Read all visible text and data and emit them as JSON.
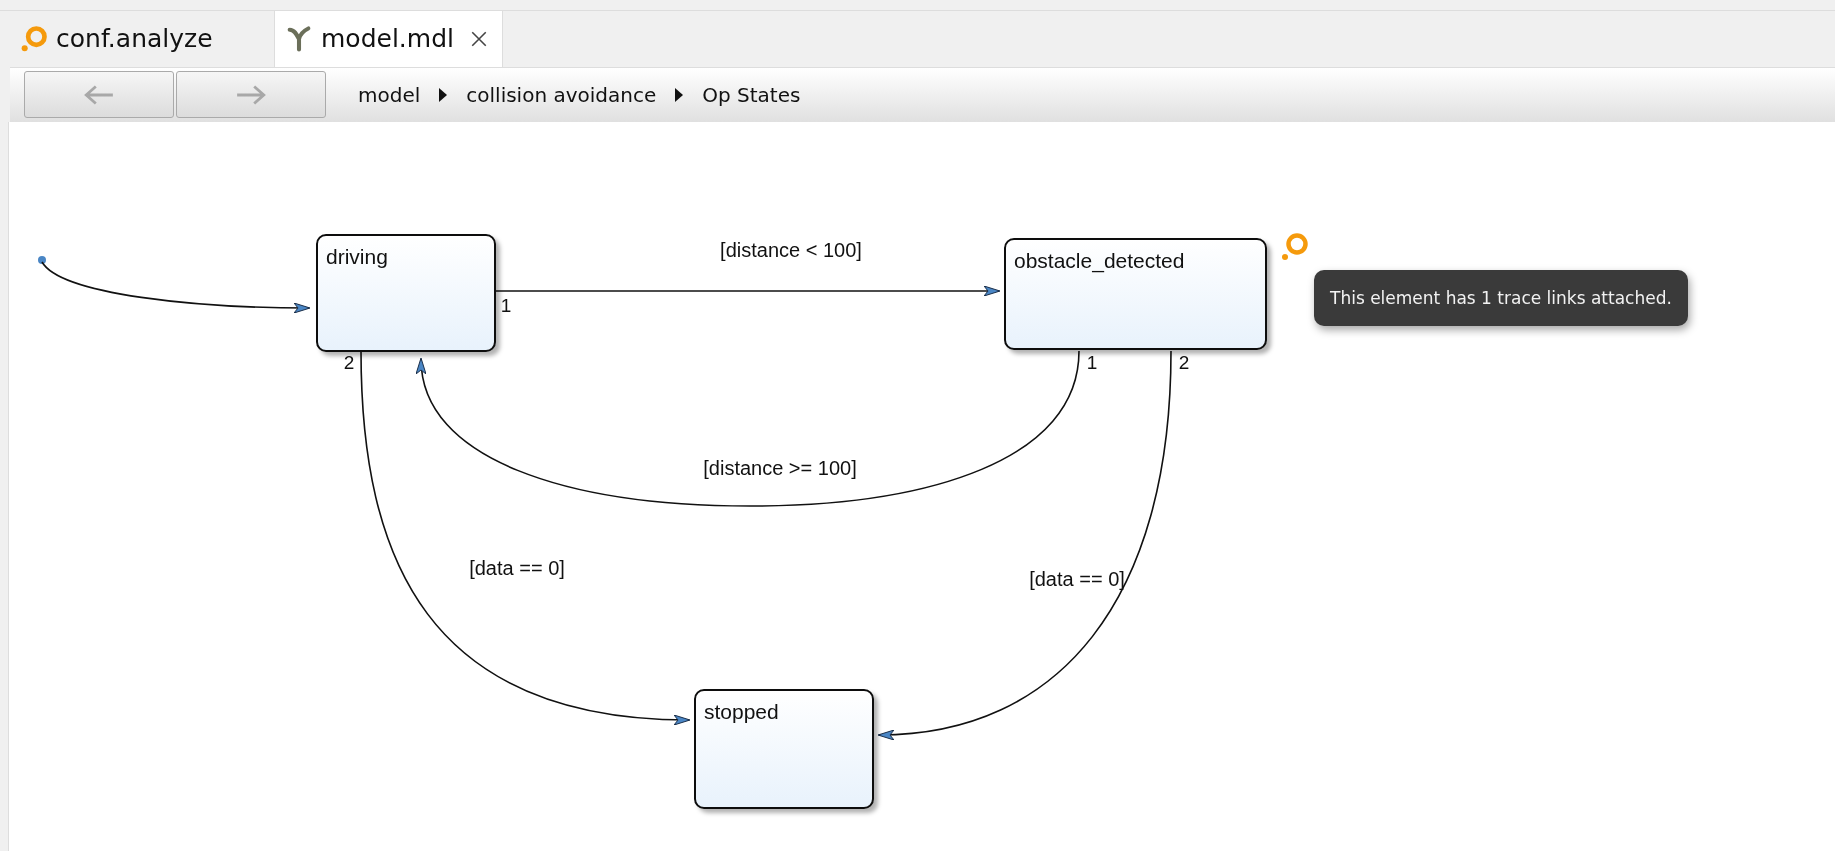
{
  "tabs": [
    {
      "label": "conf.analyze",
      "kind": "analysis",
      "selected": false,
      "closable": false
    },
    {
      "label": "model.mdl",
      "kind": "model",
      "selected": true,
      "closable": true
    }
  ],
  "toolbar": {
    "nav_buttons": [
      {
        "kind": "back",
        "disabled": true
      },
      {
        "kind": "forward",
        "disabled": true
      }
    ],
    "breadcrumb": [
      "model",
      "collision avoidance",
      "Op States"
    ]
  },
  "diagram": {
    "states": [
      {
        "name": "driving"
      },
      {
        "name": "obstacle_detected",
        "traced": true
      },
      {
        "name": "stopped"
      }
    ],
    "transitions": [
      {
        "guard": "[distance < 100]",
        "port": "1"
      },
      {
        "guard": "[data == 0]",
        "port": "2"
      },
      {
        "guard": "[distance >= 100]",
        "port": "1"
      },
      {
        "guard": "[data == 0]",
        "port": "2"
      }
    ],
    "tooltip": "This element has 1 trace links attached."
  }
}
